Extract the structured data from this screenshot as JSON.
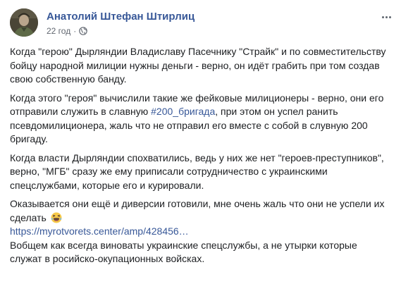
{
  "post": {
    "author": "Анатолий Штефан Штирлиц",
    "time": "22 год",
    "separator": "·",
    "audience_icon": "globe-icon",
    "more_icon": "more-options-icon",
    "paragraphs": {
      "p1": "Когда \"герою\" Дырляндии Владиславу Пасечнику \"Страйк\" и по совместительству бойцу народной милиции нужны деньги - верно, он идёт грабить при том создав свою собственную банду.",
      "p2_before": "Когда этого \"героя\" вычислили такие же фейковые милиционеры - верно, они его отправили служить в славную ",
      "p2_hashtag": "#200_бригада",
      "p2_after": ", при этом он успел ранить псевдомилиционера, жаль что не отправил его вместе с собой в слувную 200 бригаду.",
      "p3": "Когда власти Дырляндии спохватились, ведь у них же нет \"героев-преступников\", верно, \"МГБ\" сразу же ему приписали сотрудничество с украинскими спецслужбами, которые его и курировали.",
      "p4": "Оказывается они ещё и диверсии готовили, мне очень жаль что они не успели их сделать",
      "p4_emoji": "laughing-emoji",
      "link": "https://myrotvorets.center/amp/428456…",
      "p5": "Вобщем как всегда виноваты украинские спецслужбы, а не утырки которые служат в росийско-окупационных войсках."
    }
  },
  "colors": {
    "author": "#385898",
    "link": "#385898",
    "meta": "#616770",
    "text": "#1c1e21"
  }
}
